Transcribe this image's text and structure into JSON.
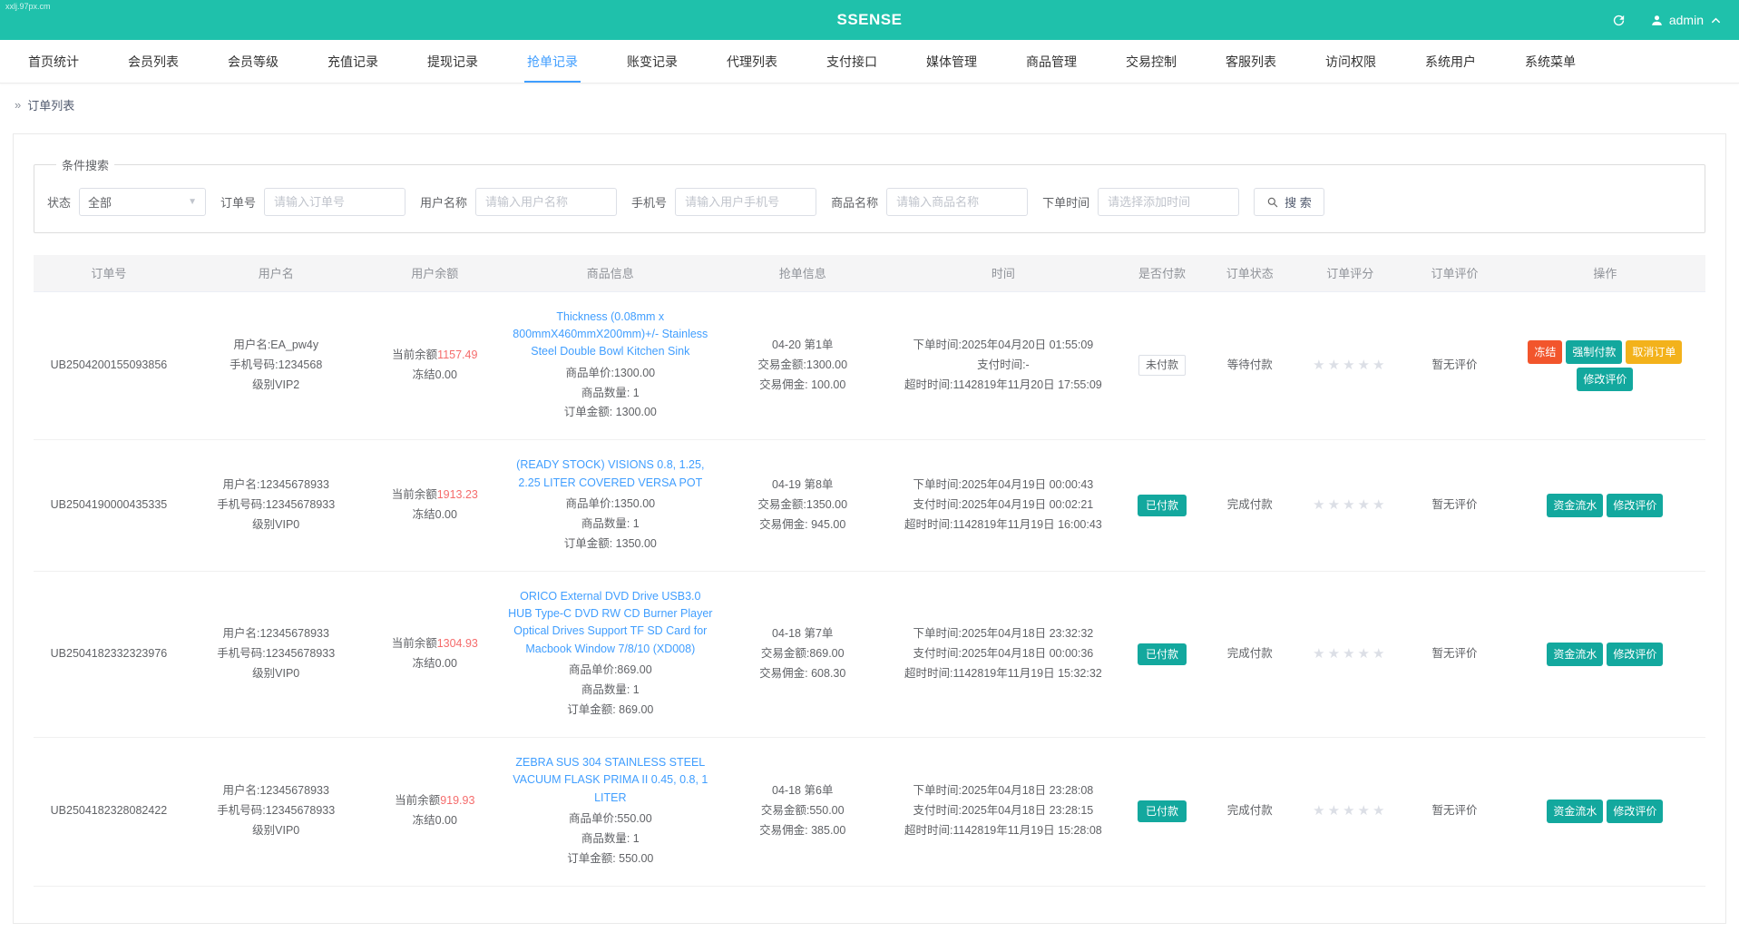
{
  "watermark": "xxlj.97px.cm",
  "header": {
    "title": "SSENSE",
    "user": "admin"
  },
  "nav": {
    "active_index": 5,
    "items": [
      "首页统计",
      "会员列表",
      "会员等级",
      "充值记录",
      "提现记录",
      "抢单记录",
      "账变记录",
      "代理列表",
      "支付接口",
      "媒体管理",
      "商品管理",
      "交易控制",
      "客服列表",
      "访问权限",
      "系统用户",
      "系统菜单"
    ]
  },
  "breadcrumb": {
    "icon": "»",
    "label": "订单列表"
  },
  "search": {
    "legend": "条件搜索",
    "status": {
      "label": "状态",
      "value": "全部"
    },
    "fields": [
      {
        "label": "订单号",
        "placeholder": "请输入订单号"
      },
      {
        "label": "用户名称",
        "placeholder": "请输入用户名称"
      },
      {
        "label": "手机号",
        "placeholder": "请输入用户手机号"
      },
      {
        "label": "商品名称",
        "placeholder": "请输入商品名称"
      },
      {
        "label": "下单时间",
        "placeholder": "请选择添加时间"
      }
    ],
    "button": "搜 索"
  },
  "table": {
    "headers": [
      "订单号",
      "用户名",
      "用户余额",
      "商品信息",
      "抢单信息",
      "时间",
      "是否付款",
      "订单状态",
      "订单评分",
      "订单评价",
      "操作"
    ],
    "rows": [
      {
        "order_no": "UB2504200155093856",
        "user": {
          "name": "用户名:EA_pw4y",
          "phone": "手机号码:1234568",
          "level": "级别VIP2"
        },
        "balance": {
          "prefix": "当前余额",
          "amount": "1157.49",
          "frozen": "冻结0.00"
        },
        "product": {
          "name": "Thickness (0.08mm x 800mmX460mmX200mm)+/- Stainless Steel Double Bowl Kitchen Sink",
          "price": "商品单价:1300.00",
          "qty": "商品数量: 1",
          "total": "订单金额: 1300.00"
        },
        "grab": {
          "seq": "04-20 第1单",
          "amount": "交易金额:1300.00",
          "commission": "交易佣金: 100.00"
        },
        "time": {
          "order": "下单时间:2025年04月20日 01:55:09",
          "pay": "支付时间:-",
          "timeout": "超时时间:1142819年11月20日 17:55:09"
        },
        "paid": "未付款",
        "status": "等待付款",
        "rating": "★★★★★",
        "review": "暂无评价",
        "actions": [
          {
            "label": "冻结"
          },
          {
            "label": "强制付款"
          },
          {
            "label": "取消订单"
          },
          {
            "label": "修改评价"
          }
        ]
      },
      {
        "order_no": "UB2504190000435335",
        "user": {
          "name": "用户名:12345678933",
          "phone": "手机号码:12345678933",
          "level": "级别VIP0"
        },
        "balance": {
          "prefix": "当前余额",
          "amount": "1913.23",
          "frozen": "冻结0.00"
        },
        "product": {
          "name": "(READY STOCK) VISIONS 0.8, 1.25, 2.25 LITER COVERED VERSA POT",
          "price": "商品单价:1350.00",
          "qty": "商品数量: 1",
          "total": "订单金额: 1350.00"
        },
        "grab": {
          "seq": "04-19 第8单",
          "amount": "交易金额:1350.00",
          "commission": "交易佣金: 945.00"
        },
        "time": {
          "order": "下单时间:2025年04月19日 00:00:43",
          "pay": "支付时间:2025年04月19日 00:02:21",
          "timeout": "超时时间:1142819年11月19日 16:00:43"
        },
        "paid": "已付款",
        "status": "完成付款",
        "rating": "★★★★★",
        "review": "暂无评价",
        "actions": [
          {
            "label": "资金流水"
          },
          {
            "label": "修改评价"
          }
        ]
      },
      {
        "order_no": "UB2504182332323976",
        "user": {
          "name": "用户名:12345678933",
          "phone": "手机号码:12345678933",
          "level": "级别VIP0"
        },
        "balance": {
          "prefix": "当前余额",
          "amount": "1304.93",
          "frozen": "冻结0.00"
        },
        "product": {
          "name": "ORICO External DVD Drive USB3.0 HUB Type-C DVD RW CD Burner Player Optical Drives Support TF SD Card for Macbook Window 7/8/10 (XD008)",
          "price": "商品单价:869.00",
          "qty": "商品数量: 1",
          "total": "订单金额: 869.00"
        },
        "grab": {
          "seq": "04-18 第7单",
          "amount": "交易金额:869.00",
          "commission": "交易佣金: 608.30"
        },
        "time": {
          "order": "下单时间:2025年04月18日 23:32:32",
          "pay": "支付时间:2025年04月18日 00:00:36",
          "timeout": "超时时间:1142819年11月19日 15:32:32"
        },
        "paid": "已付款",
        "status": "完成付款",
        "rating": "★★★★★",
        "review": "暂无评价",
        "actions": [
          {
            "label": "资金流水"
          },
          {
            "label": "修改评价"
          }
        ]
      },
      {
        "order_no": "UB2504182328082422",
        "user": {
          "name": "用户名:12345678933",
          "phone": "手机号码:12345678933",
          "level": "级别VIP0"
        },
        "balance": {
          "prefix": "当前余额",
          "amount": "919.93",
          "frozen": "冻结0.00"
        },
        "product": {
          "name": "ZEBRA SUS 304 STAINLESS STEEL VACUUM FLASK PRIMA II 0.45, 0.8, 1 LITER",
          "price": "商品单价:550.00",
          "qty": "商品数量: 1",
          "total": "订单金额: 550.00"
        },
        "grab": {
          "seq": "04-18 第6单",
          "amount": "交易金额:550.00",
          "commission": "交易佣金: 385.00"
        },
        "time": {
          "order": "下单时间:2025年04月18日 23:28:08",
          "pay": "支付时间:2025年04月18日 23:28:15",
          "timeout": "超时时间:1142819年11月19日 15:28:08"
        },
        "paid": "已付款",
        "status": "完成付款",
        "rating": "★★★★★",
        "review": "暂无评价",
        "actions": [
          {
            "label": "资金流水"
          },
          {
            "label": "修改评价"
          }
        ]
      }
    ]
  },
  "colors": {
    "header_teal": "#1fc1ab",
    "active_blue": "#409eff",
    "link_blue": "#409eff",
    "amount_red": "#f56c6c",
    "badge_teal": "#13a89e",
    "danger_orange": "#f2552c",
    "warning_amber": "#f3b21b"
  }
}
